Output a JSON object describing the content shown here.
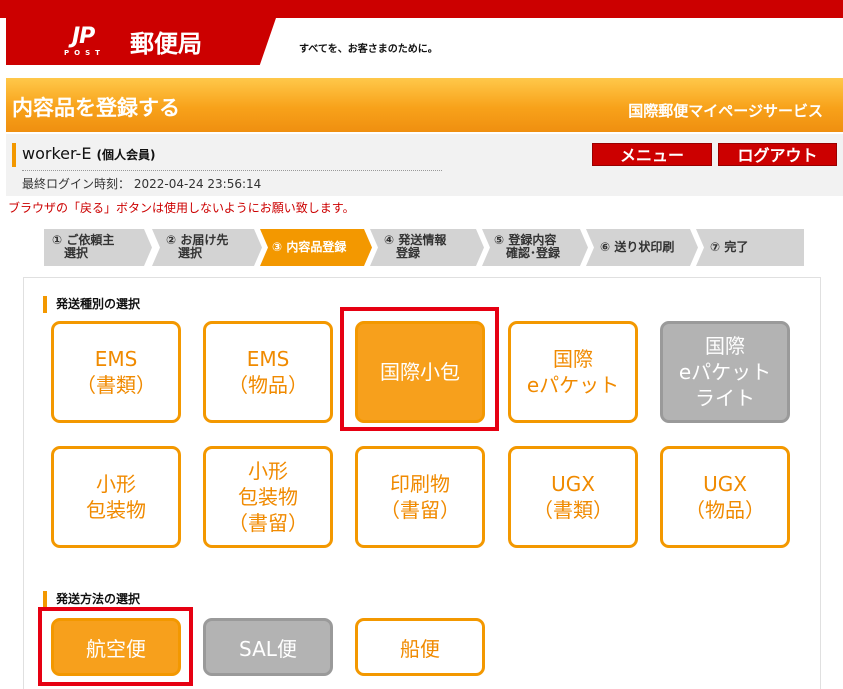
{
  "header": {
    "logo_mark": "JP",
    "logo_sub": "POST",
    "logo_name": "郵便局",
    "tagline": "すべてを、お客さまのために。"
  },
  "titlebar": {
    "page_title": "内容品を登録する",
    "service_title": "国際郵便マイページサービス"
  },
  "user": {
    "name": "worker-E",
    "member_type": "(個人会員)",
    "last_login_label": "最終ログイン時刻：",
    "last_login_value": "2022-04-24 23:56:14",
    "menu_label": "メニュー",
    "logout_label": "ログアウト"
  },
  "warning": "ブラウザの「戻る」ボタンは使用しないようにお願い致します。",
  "steps": [
    {
      "label": "① ご依頼主\n　選択",
      "active": false
    },
    {
      "label": "② お届け先\n　選択",
      "active": false
    },
    {
      "label": "③ 内容品登録",
      "active": true
    },
    {
      "label": "④ 発送情報\n　登録",
      "active": false
    },
    {
      "label": "⑤ 登録内容\n　確認･登録",
      "active": false
    },
    {
      "label": "⑥ 送り状印刷",
      "active": false
    },
    {
      "label": "⑦ 完了",
      "active": false
    }
  ],
  "shipping_type": {
    "heading": "発送種別の選択",
    "options": [
      {
        "label": "EMS\n（書類）",
        "state": "normal"
      },
      {
        "label": "EMS\n（物品）",
        "state": "normal"
      },
      {
        "label": "国際小包",
        "state": "selected"
      },
      {
        "label": "国際\neパケット",
        "state": "normal"
      },
      {
        "label": "国際\neパケット\nライト",
        "state": "disabled"
      },
      {
        "label": "小形\n包装物",
        "state": "normal"
      },
      {
        "label": "小形\n包装物\n（書留）",
        "state": "normal"
      },
      {
        "label": "印刷物\n（書留）",
        "state": "normal"
      },
      {
        "label": "UGX\n（書類）",
        "state": "normal"
      },
      {
        "label": "UGX\n（物品）",
        "state": "normal"
      }
    ]
  },
  "shipping_method": {
    "heading": "発送方法の選択",
    "options": [
      {
        "label": "航空便",
        "state": "selected"
      },
      {
        "label": "SAL便",
        "state": "disabled"
      },
      {
        "label": "船便",
        "state": "normal"
      }
    ]
  },
  "colors": {
    "brand_red": "#cc0000",
    "accent_orange": "#f39800",
    "highlight_red": "#e60012"
  }
}
